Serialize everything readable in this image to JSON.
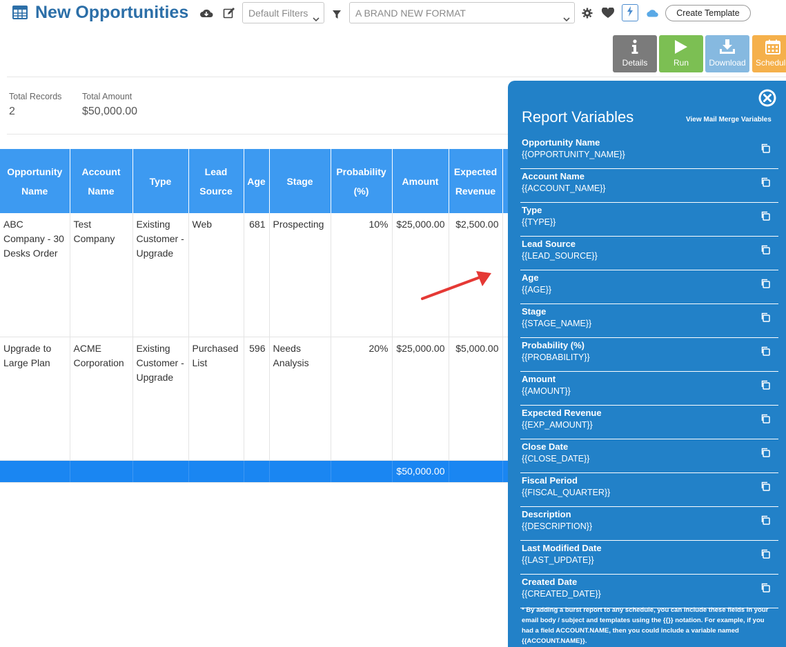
{
  "header": {
    "title": "New Opportunities",
    "filter_select": "Default Filters",
    "format_select": "A BRAND NEW FORMAT",
    "create_template_label": "Create Template"
  },
  "actions": {
    "details": "Details",
    "run": "Run",
    "download": "Download",
    "schedule": "Schedule"
  },
  "summary": {
    "total_records_label": "Total Records",
    "total_records_value": "2",
    "total_amount_label": "Total Amount",
    "total_amount_value": "$50,000.00"
  },
  "table": {
    "headers": [
      "Opportunity Name",
      "Account Name",
      "Type",
      "Lead Source",
      "Age",
      "Stage",
      "Probability (%)",
      "Amount",
      "Expected Revenue"
    ],
    "rows": [
      [
        "ABC Company - 30 Desks Order",
        "Test Company",
        "Existing Customer - Upgrade",
        "Web",
        "681",
        "Prospecting",
        "10%",
        "$25,000.00",
        "$2,500.00"
      ],
      [
        "Upgrade to Large Plan",
        "ACME Corporation",
        "Existing Customer - Upgrade",
        "Purchased List",
        "596",
        "Needs Analysis",
        "20%",
        "$25,000.00",
        "$5,000.00"
      ]
    ],
    "total_amount": "$50,000.00"
  },
  "panel": {
    "title": "Report Variables",
    "mail_merge_link": "View Mail Merge Variables",
    "variables": [
      {
        "name": "Opportunity Name",
        "token": "{{OPPORTUNITY_NAME}}"
      },
      {
        "name": "Account Name",
        "token": "{{ACCOUNT_NAME}}"
      },
      {
        "name": "Type",
        "token": "{{TYPE}}"
      },
      {
        "name": "Lead Source",
        "token": "{{LEAD_SOURCE}}"
      },
      {
        "name": "Age",
        "token": "{{AGE}}"
      },
      {
        "name": "Stage",
        "token": "{{STAGE_NAME}}"
      },
      {
        "name": "Probability (%)",
        "token": "{{PROBABILITY}}"
      },
      {
        "name": "Amount",
        "token": "{{AMOUNT}}"
      },
      {
        "name": "Expected Revenue",
        "token": "{{EXP_AMOUNT}}"
      },
      {
        "name": "Close Date",
        "token": "{{CLOSE_DATE}}"
      },
      {
        "name": "Fiscal Period",
        "token": "{{FISCAL_QUARTER}}"
      },
      {
        "name": "Description",
        "token": "{{DESCRIPTION}}"
      },
      {
        "name": "Last Modified Date",
        "token": "{{LAST_UPDATE}}"
      },
      {
        "name": "Created Date",
        "token": "{{CREATED_DATE}}"
      }
    ],
    "note": "* By adding a burst report to any schedule, you can include these fields in your email body / subject and templates using the {{}} notation. For example, if you had a field ACCOUNT.NAME, then you could include a variable named {{ACCOUNT.NAME}}."
  },
  "colors": {
    "title": "#2c6fa8",
    "header_blue": "#3d9af1",
    "total_row": "#1a86f2",
    "panel": "#2281c8",
    "run": "#7cbf53",
    "details": "#7b7b7b",
    "download": "#86b9e0",
    "schedule": "#f5b04b",
    "arrow": "#e53935"
  },
  "icons": [
    "table-icon",
    "cloud-download-icon",
    "edit-icon",
    "chevron-down-icon",
    "filter-icon",
    "gear-icon",
    "heart-icon",
    "bolt-icon",
    "cloud-icon",
    "info-icon",
    "play-icon",
    "download-icon",
    "calendar-icon",
    "close-circle-icon",
    "copy-icon",
    "arrow-annotation"
  ]
}
